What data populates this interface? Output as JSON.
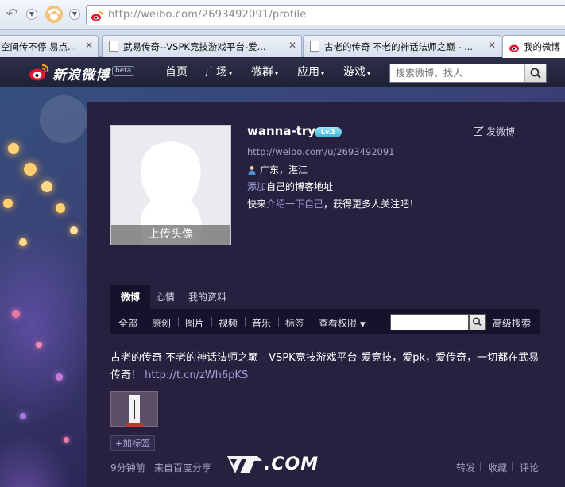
{
  "browser": {
    "url": "http://weibo.com/2693492091/profile",
    "tabs": [
      {
        "label": "空间传不停 易点..."
      },
      {
        "label": "武易传奇--VSPK竞技游戏平台-爱..."
      },
      {
        "label": "古老的传奇 不老的神话法师之巅 - ..."
      },
      {
        "label": "我的微博"
      }
    ]
  },
  "weibo": {
    "logo_text": "新浪微博",
    "beta": "beta",
    "menu": [
      "首页",
      "广场",
      "微群",
      "应用",
      "游戏"
    ],
    "search_placeholder": "搜索微博、找人"
  },
  "profile": {
    "avatar_upload": "上传头像",
    "username": "wanna-try",
    "level": "Lv.1",
    "url": "http://weibo.com/u/2693492091",
    "location": "广东，湛江",
    "blog_add": "添加",
    "blog_rest": "自己的博客地址",
    "intro_pre": "快来",
    "intro_link": "介绍一下自己",
    "intro_post": "，获得更多人关注吧！",
    "post_button": "发微博"
  },
  "tabs": [
    "微博",
    "心情",
    "我的资料"
  ],
  "filters": [
    "全部",
    "原创",
    "图片",
    "视频",
    "音乐",
    "标签",
    "查看权限"
  ],
  "advanced_search": "高级搜索",
  "post": {
    "text": "古老的传奇 不老的神话法师之巅 - VSPK竞技游戏平台-爱竞技，爱pk，爱传奇，一切都在武易传奇！",
    "link": "http://t.cn/zWh6pKS",
    "add_tag": "+加标签",
    "time": "9分钟前",
    "source": "来自百度分享",
    "actions": [
      "转发",
      "收藏",
      "评论"
    ]
  },
  "watermark": ".COM"
}
